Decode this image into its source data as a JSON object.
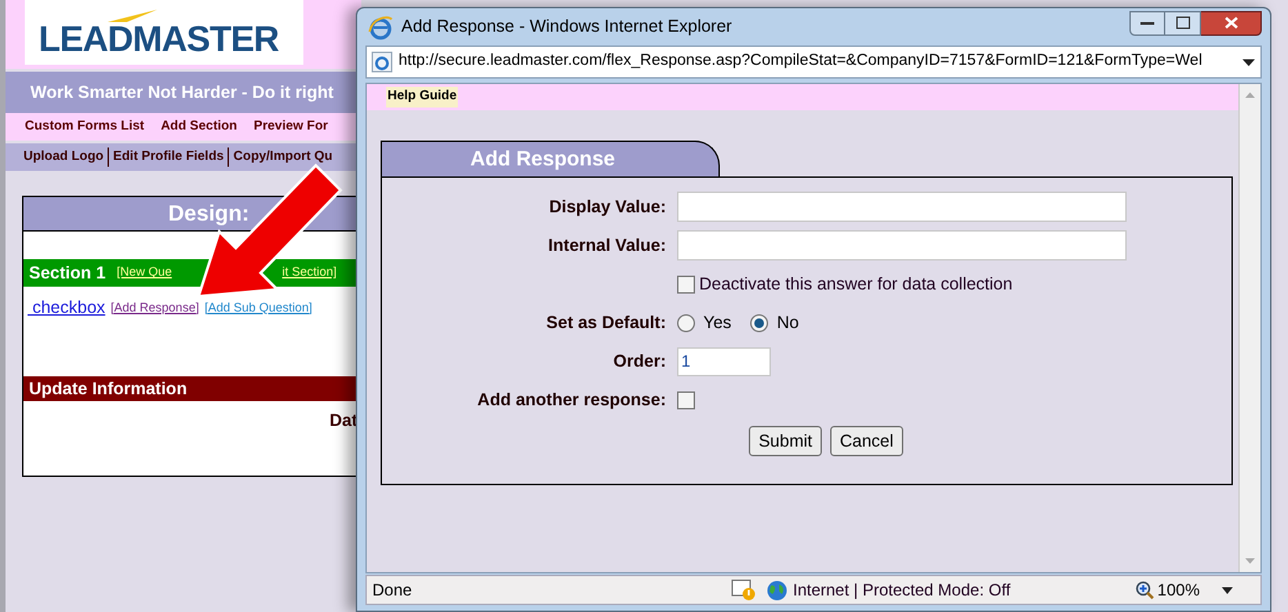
{
  "background_page": {
    "logo": "LEADMASTER",
    "tagline": "Work Smarter Not Harder - Do it right",
    "menu": [
      "Custom Forms List",
      "Add Section",
      "Preview For"
    ],
    "submenu": [
      "Upload Logo",
      "Edit Profile Fields",
      "Copy/Import Qu"
    ],
    "design_title": "Design:",
    "section": {
      "title": "Section 1",
      "links": [
        "[New Que",
        "it Section]"
      ]
    },
    "question": {
      "label": "checkbox",
      "links": [
        "[Add Response]",
        "[Add Sub Question]"
      ]
    },
    "update_title": "Update Information",
    "date_label": "Dat"
  },
  "popup": {
    "title": "Add Response - Windows Internet Explorer",
    "address": "http://secure.leadmaster.com/flex_Response.asp?CompileStat=&CompanyID=7157&FormID=121&FormType=Wel",
    "help_link": "Help Guide",
    "tab": "Add Response",
    "fields": [
      {
        "kind": "text",
        "label": "Display Value:"
      },
      {
        "kind": "text",
        "label": "Internal Value:"
      },
      {
        "kind": "checkbox",
        "text": "Deactivate this answer for data collection",
        "checked": false
      },
      {
        "kind": "radio",
        "label": "Set as Default:",
        "options": [
          {
            "text": "Yes",
            "selected": false
          },
          {
            "text": "No",
            "selected": true
          }
        ]
      },
      {
        "kind": "short",
        "label": "Order:",
        "value": "1"
      },
      {
        "kind": "checkbox",
        "label": "Add another response:",
        "checked": false
      }
    ],
    "buttons": [
      "Submit",
      "Cancel"
    ],
    "status_bar": {
      "text": "Done",
      "zone": "Internet | Protected Mode: Off",
      "zoom": "100%"
    }
  }
}
